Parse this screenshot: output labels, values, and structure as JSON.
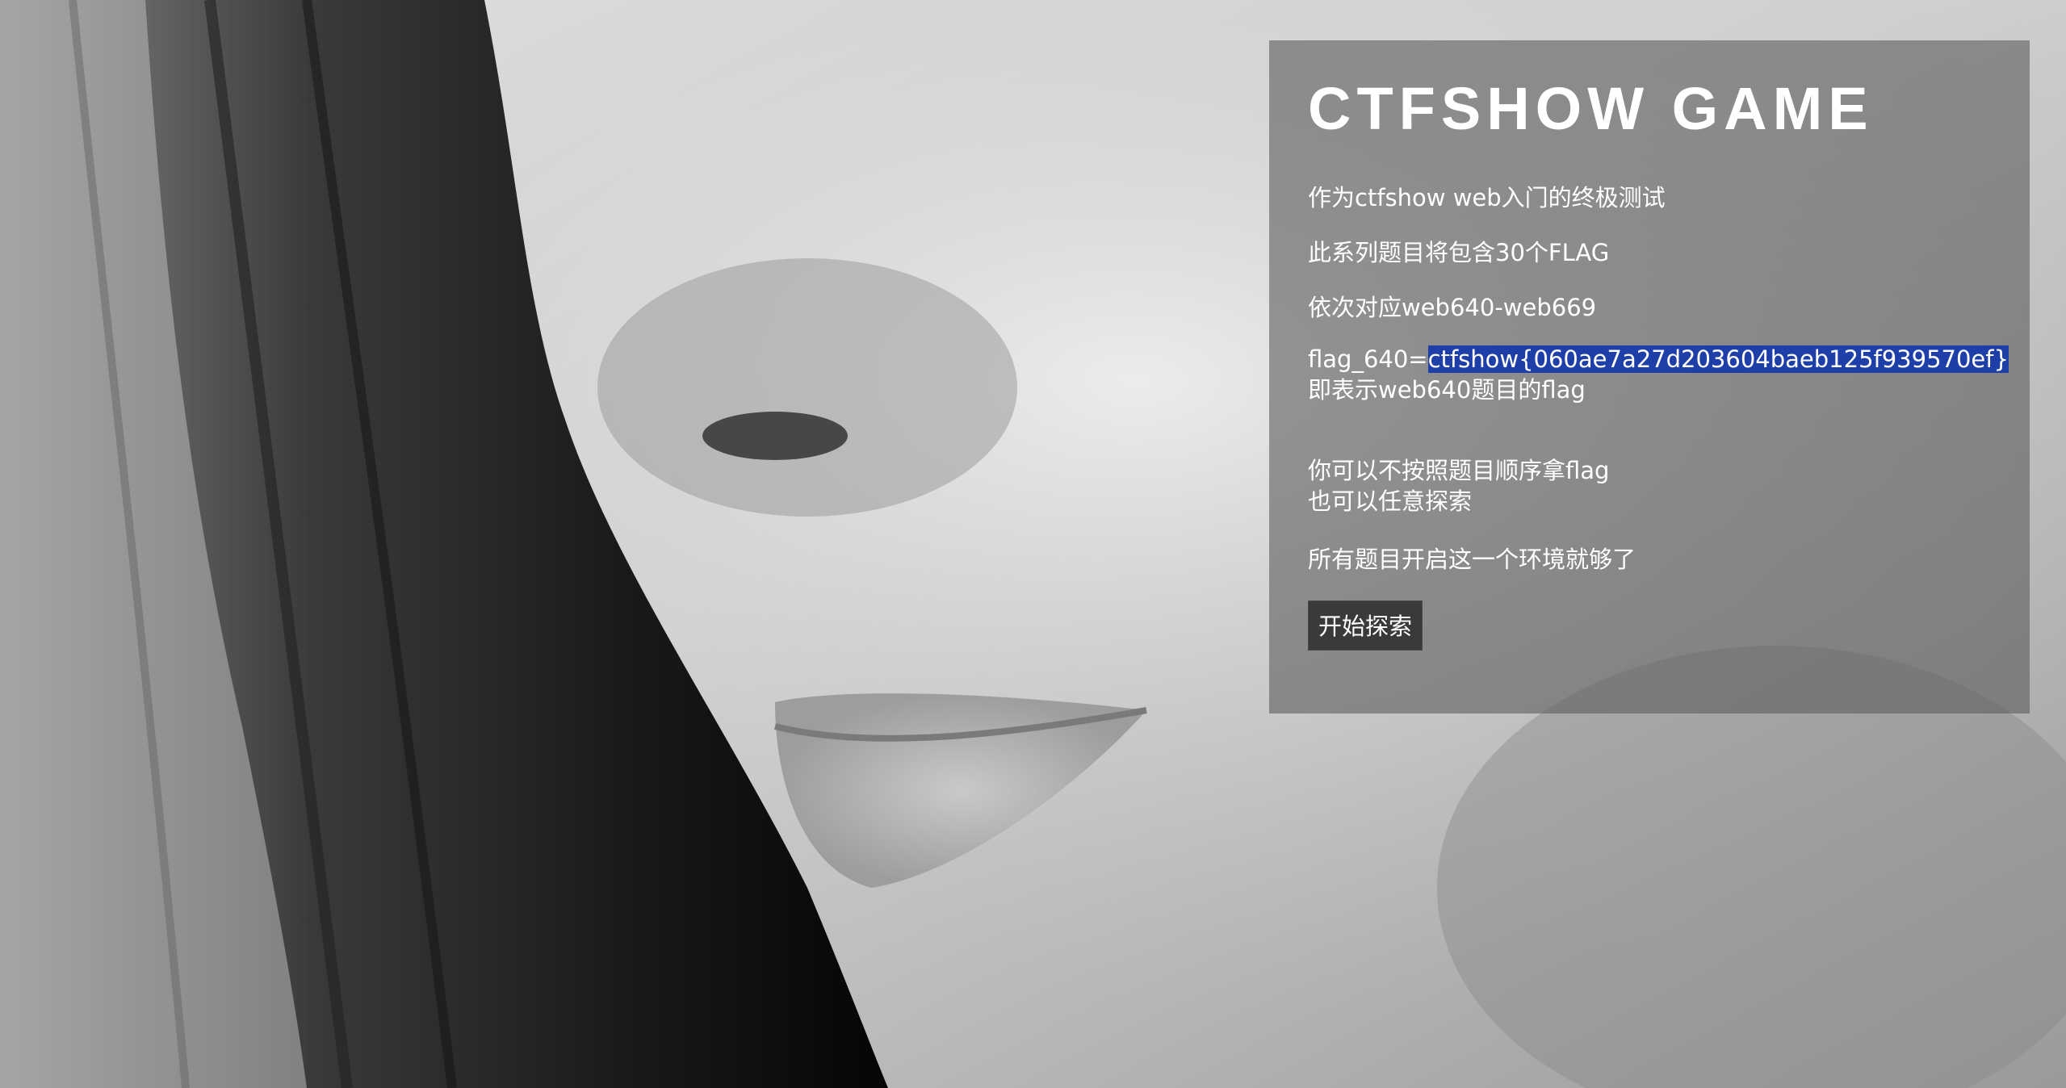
{
  "header": {
    "title": "CTFSHOW GAME"
  },
  "intro": {
    "line1": "作为ctfshow web入门的终极测试",
    "line2": "此系列题目将包含30个FLAG",
    "line3": "依次对应web640-web669",
    "flag_prefix": "flag_640=",
    "flag_value": "ctfshow{060ae7a27d203604baeb125f939570ef}",
    "flag_note": "即表示web640题目的flag",
    "line4": "你可以不按照题目顺序拿flag",
    "line5": "也可以任意探索",
    "line6": "所有题目开启这一个环境就够了"
  },
  "actions": {
    "start_label": "开始探索"
  },
  "colors": {
    "panel_bg": "#5f5f5f",
    "flag_highlight": "#1f3fa8",
    "button_bg": "#3a3a3a",
    "text": "#ffffff"
  }
}
